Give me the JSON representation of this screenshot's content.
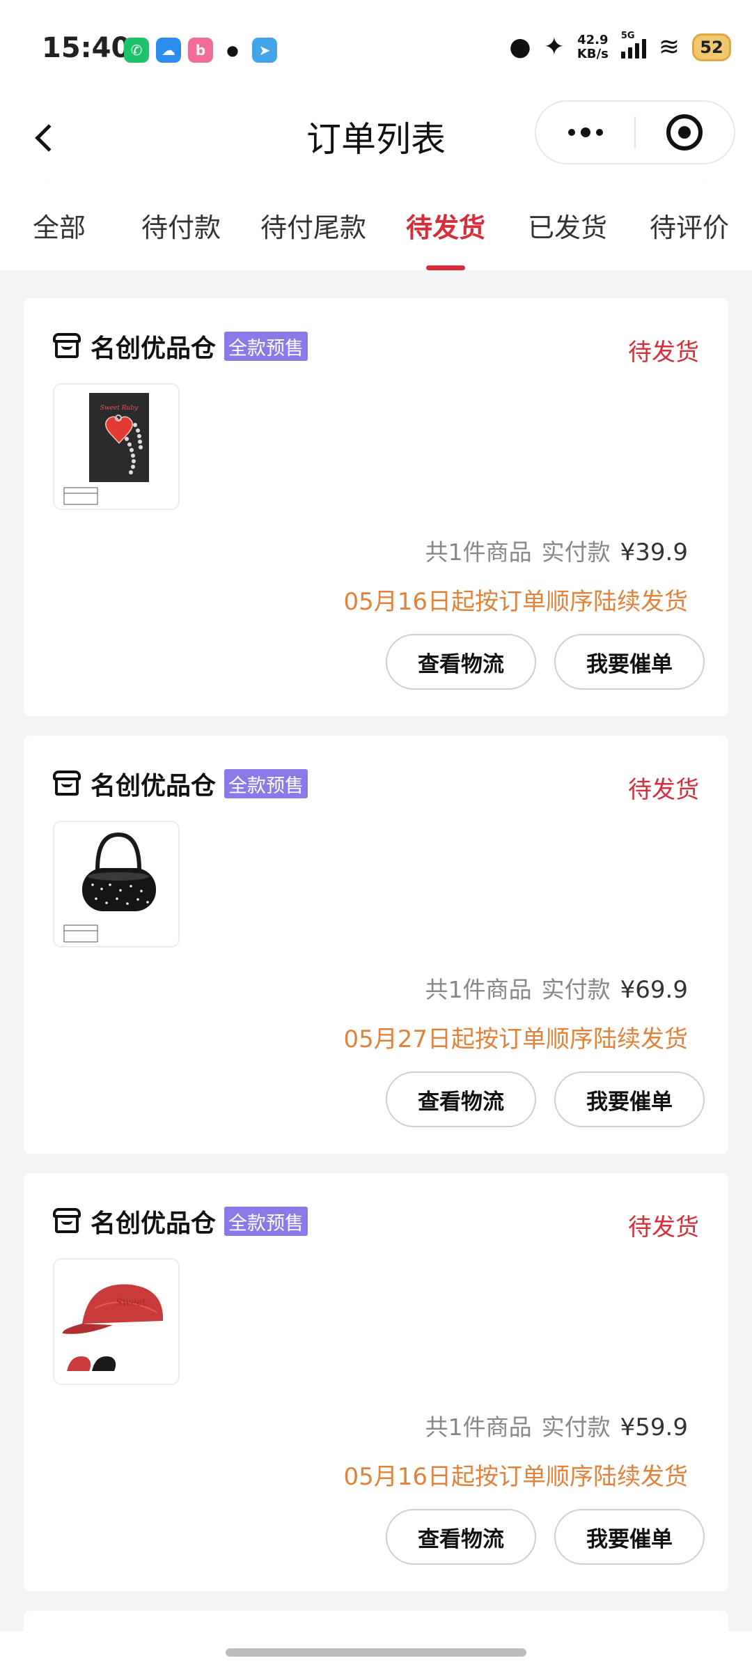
{
  "status_bar": {
    "time": "15:40",
    "speed_value": "42.9",
    "speed_unit": "KB/s",
    "network": "5G",
    "battery": "52",
    "notification_icons": [
      "wechat-icon",
      "cloud-app-icon",
      "bilibili-icon",
      "qq-icon",
      "telegram-icon"
    ]
  },
  "nav": {
    "title": "订单列表",
    "back_icon": "chevron-left-icon",
    "more_icon": "more-dots-icon",
    "close_icon": "target-circle-icon"
  },
  "tabs": [
    {
      "label": "全部",
      "active": false
    },
    {
      "label": "待付款",
      "active": false
    },
    {
      "label": "待付尾款",
      "active": false
    },
    {
      "label": "待发货",
      "active": true
    },
    {
      "label": "已发货",
      "active": false
    },
    {
      "label": "待评价",
      "active": false
    }
  ],
  "orders": [
    {
      "store_name": "名创优品仓",
      "badge": "全款预售",
      "status": "待发货",
      "product_thumb": "heart-keychain-product-image",
      "item_count_text": "共1件商品",
      "paid_label": "实付款",
      "price": "¥39.9",
      "shipping_note": "05月16日起按订单顺序陆续发货",
      "btn_logistics": "查看物流",
      "btn_urge": "我要催单"
    },
    {
      "store_name": "名创优品仓",
      "badge": "全款预售",
      "status": "待发货",
      "product_thumb": "black-handbag-product-image",
      "item_count_text": "共1件商品",
      "paid_label": "实付款",
      "price": "¥69.9",
      "shipping_note": "05月27日起按订单顺序陆续发货",
      "btn_logistics": "查看物流",
      "btn_urge": "我要催单"
    },
    {
      "store_name": "名创优品仓",
      "badge": "全款预售",
      "status": "待发货",
      "product_thumb": "red-cap-product-image",
      "item_count_text": "共1件商品",
      "paid_label": "实付款",
      "price": "¥59.9",
      "shipping_note": "05月16日起按订单顺序陆续发货",
      "btn_logistics": "查看物流",
      "btn_urge": "我要催单"
    }
  ],
  "colors": {
    "accent_red": "#d52e3a",
    "badge_purple": "#8b79e8",
    "note_orange": "#e0823a",
    "background": "#f4f4f4"
  }
}
